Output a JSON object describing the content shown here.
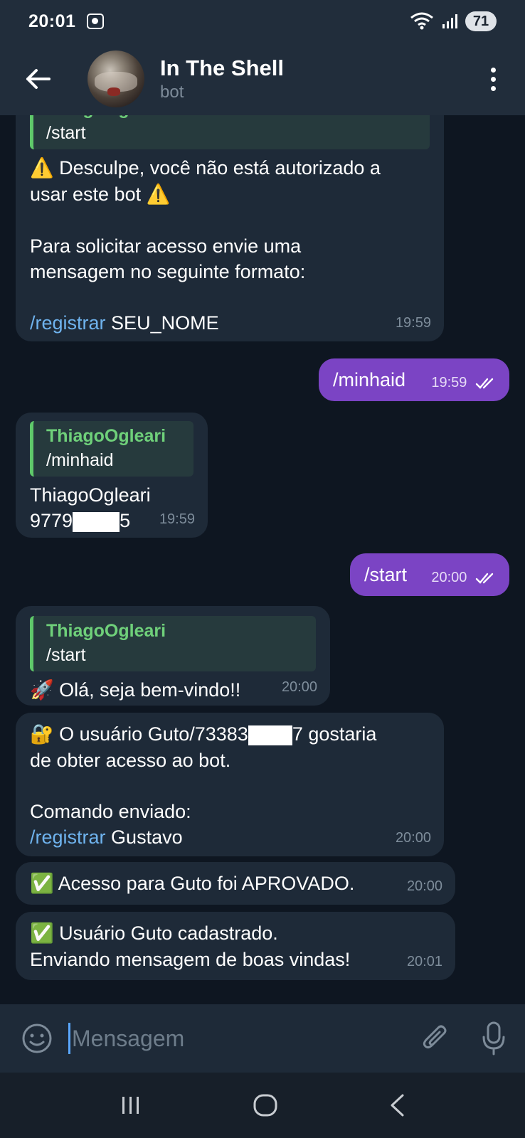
{
  "status": {
    "time": "20:01",
    "battery": "71"
  },
  "header": {
    "title": "In The Shell",
    "subtitle": "bot"
  },
  "messages": {
    "m1": {
      "reply_name": "ThiagoOgleari",
      "reply_text": "/start",
      "line1": "Desculpe, você não está autorizado a",
      "line2": "usar este bot",
      "line3": "Para solicitar acesso envie uma",
      "line4": "mensagem no seguinte formato:",
      "cmd": "/registrar",
      "cmd_arg": "SEU_NOME",
      "time": "19:59"
    },
    "m2": {
      "text": "/minhaid",
      "time": "19:59"
    },
    "m3": {
      "reply_name": "ThiagoOgleari",
      "reply_text": "/minhaid",
      "line1": "ThiagoOgleari",
      "id_start": "9779",
      "id_end": "5",
      "time": "19:59"
    },
    "m4": {
      "text": "/start",
      "time": "20:00"
    },
    "m5": {
      "reply_name": "ThiagoOgleari",
      "reply_text": "/start",
      "text": "Olá, seja bem-vindo!!",
      "time": "20:00"
    },
    "m6": {
      "line1_start": "O usuário Guto/73383",
      "line1_end": "7 gostaria",
      "line2": "de obter acesso ao bot.",
      "line3": "Comando enviado:",
      "cmd": "/registrar",
      "cmd_arg": "Gustavo",
      "time": "20:00"
    },
    "m7": {
      "text": "Acesso para Guto foi APROVADO.",
      "time": "20:00"
    },
    "m8": {
      "line1": "Usuário Guto cadastrado.",
      "line2": "Enviando mensagem de boas vindas!",
      "time": "20:01"
    }
  },
  "input": {
    "placeholder": "Mensagem"
  },
  "colors": {
    "header_bg": "#212d3b",
    "chat_bg": "#0e1621",
    "incoming_bubble": "#1e2a38",
    "outgoing_bubble": "#7b44c4",
    "reply_name": "#6fd07a",
    "link": "#6fb3ee"
  },
  "icons": {
    "back": "arrow-left-icon",
    "menu": "more-vertical-icon",
    "emoji": "smiley-icon",
    "attach": "paperclip-icon",
    "mic": "microphone-icon",
    "warning": "warning-icon",
    "rocket": "rocket-icon",
    "lock": "lock-key-icon",
    "check": "check-mark-icon"
  }
}
